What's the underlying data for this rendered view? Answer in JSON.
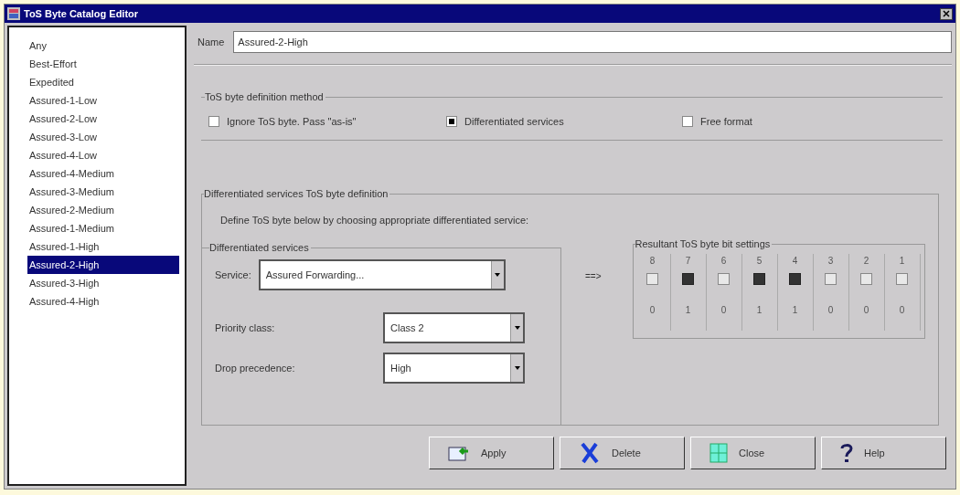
{
  "window": {
    "title": "ToS Byte Catalog Editor"
  },
  "catalog": [
    {
      "label": "Any",
      "selected": false
    },
    {
      "label": "Best-Effort",
      "selected": false
    },
    {
      "label": "Expedited",
      "selected": false
    },
    {
      "label": "Assured-1-Low",
      "selected": false
    },
    {
      "label": "Assured-2-Low",
      "selected": false
    },
    {
      "label": "Assured-3-Low",
      "selected": false
    },
    {
      "label": "Assured-4-Low",
      "selected": false
    },
    {
      "label": "Assured-4-Medium",
      "selected": false
    },
    {
      "label": "Assured-3-Medium",
      "selected": false
    },
    {
      "label": "Assured-2-Medium",
      "selected": false
    },
    {
      "label": "Assured-1-Medium",
      "selected": false
    },
    {
      "label": "Assured-1-High",
      "selected": false
    },
    {
      "label": "Assured-2-High",
      "selected": true
    },
    {
      "label": "Assured-3-High",
      "selected": false
    },
    {
      "label": "Assured-4-High",
      "selected": false
    }
  ],
  "name": {
    "label": "Name",
    "value": "Assured-2-High"
  },
  "method": {
    "title": "ToS byte definition method",
    "options": [
      {
        "label": "Ignore ToS byte. Pass \"as-is\"",
        "selected": false
      },
      {
        "label": "Differentiated services",
        "selected": true
      },
      {
        "label": "Free format",
        "selected": false
      }
    ]
  },
  "definition": {
    "title": "Differentiated services ToS byte definition",
    "hint": "Define ToS byte below by choosing appropriate differentiated service:",
    "services": {
      "title": "Differentiated services",
      "fields": [
        {
          "label": "Service:",
          "value": "Assured Forwarding..."
        },
        {
          "label": "Priority class:",
          "value": "Class 2"
        },
        {
          "label": "Drop precedence:",
          "value": "High"
        }
      ]
    },
    "arrow": "==>",
    "bits": {
      "title": "Resultant ToS byte bit settings",
      "items": [
        {
          "number": "8",
          "checked": false,
          "value": "0"
        },
        {
          "number": "7",
          "checked": true,
          "value": "1"
        },
        {
          "number": "6",
          "checked": false,
          "value": "0"
        },
        {
          "number": "5",
          "checked": true,
          "value": "1"
        },
        {
          "number": "4",
          "checked": true,
          "value": "1"
        },
        {
          "number": "3",
          "checked": false,
          "value": "0"
        },
        {
          "number": "2",
          "checked": false,
          "value": "0"
        },
        {
          "number": "1",
          "checked": false,
          "value": "0"
        }
      ]
    }
  },
  "buttons": [
    {
      "kind": "apply",
      "label": "Apply"
    },
    {
      "kind": "delete",
      "label": "Delete"
    },
    {
      "kind": "close",
      "label": "Close"
    },
    {
      "kind": "help",
      "label": "Help"
    }
  ]
}
